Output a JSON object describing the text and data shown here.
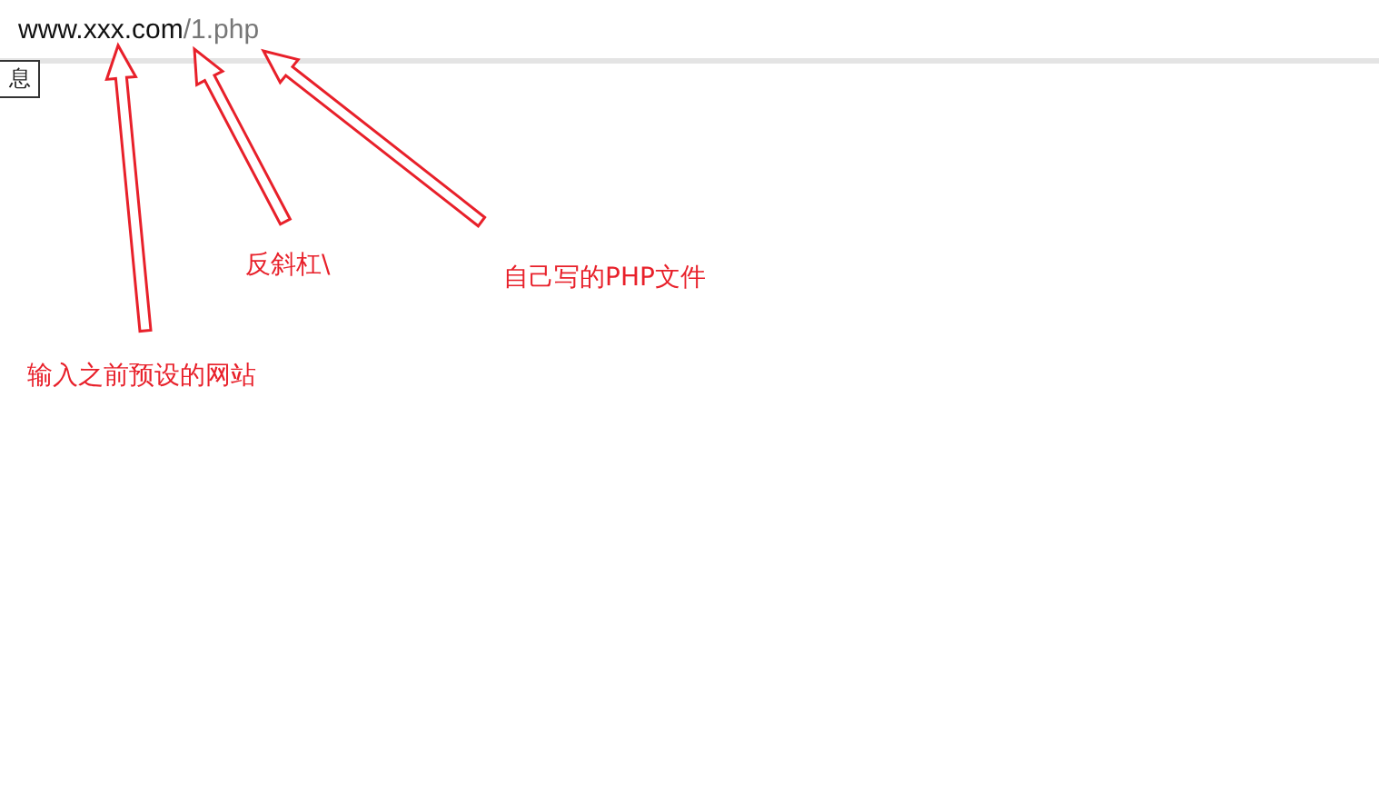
{
  "address_bar": {
    "host": "www.xxx.com",
    "path": "/1.php"
  },
  "tooltip": {
    "text": "息"
  },
  "annotations": [
    {
      "text": "反斜杠\\"
    },
    {
      "text": "自己写的PHP文件"
    },
    {
      "text": "输入之前预设的网站"
    }
  ]
}
